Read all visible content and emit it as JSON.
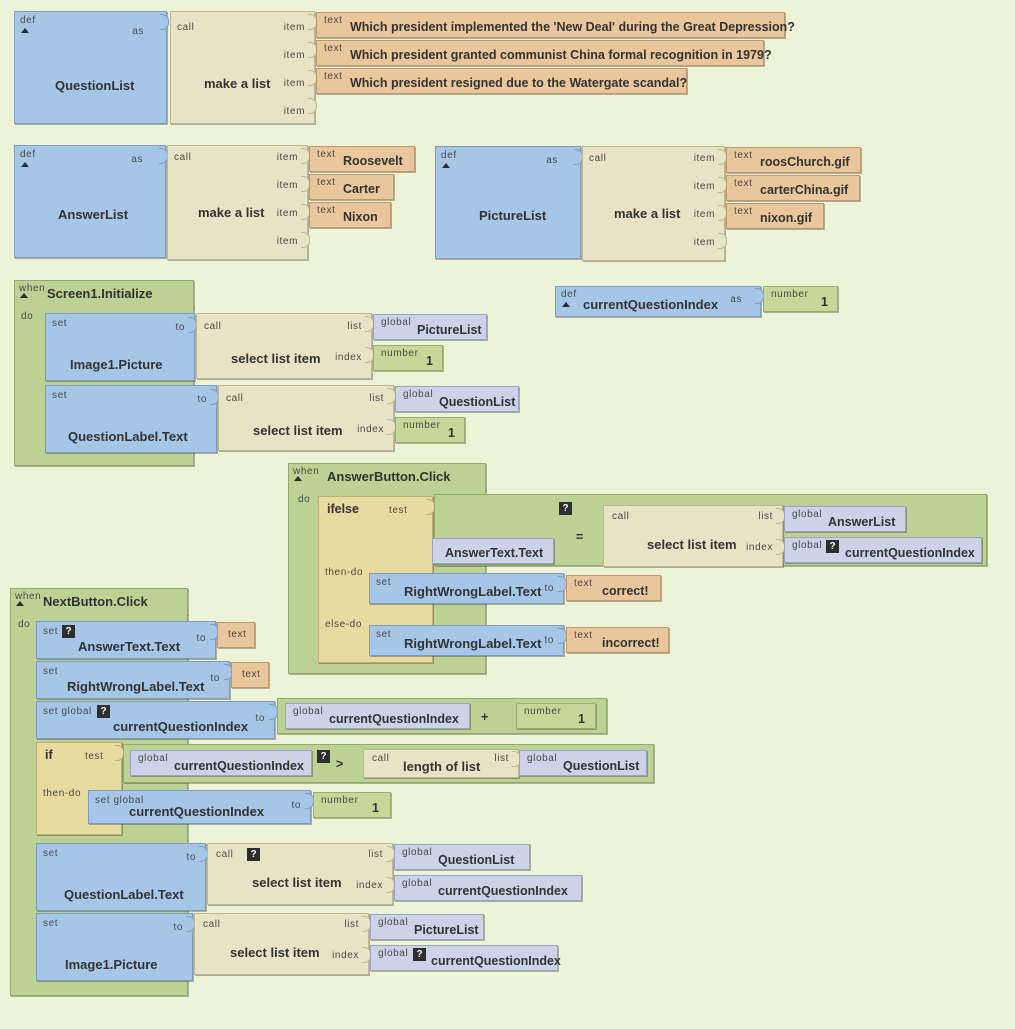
{
  "app": {
    "title": "App Inventor Blocks Editor",
    "canvas_background": "#edf3d6"
  },
  "palette": {
    "variable_blue": "#a6c6e8",
    "call_cream": "#e8e3c4",
    "text_orange": "#e9c69b",
    "event_green": "#bcd194",
    "control_gold": "#e9da9f",
    "global_lavender": "#ccd3e8",
    "number_olive": "#c6d79a"
  },
  "captions": {
    "def": "def",
    "as": "as",
    "call": "call",
    "item": "item",
    "text": "text",
    "to": "to",
    "list": "list",
    "index": "index",
    "number": "number",
    "global": "global",
    "when": "when",
    "do": "do",
    "test": "test",
    "set": "set",
    "set_global": "set global",
    "then_do": "then-do",
    "else_do": "else-do",
    "if": "if",
    "ifelse": "ifelse"
  },
  "blocks": {
    "question_list": {
      "def_name": "QuestionList",
      "make_a_list": "make a list",
      "items": [
        "Which president implemented the 'New Deal' during the Great Depression?",
        "Which president granted communist China formal recognition in 1979?",
        "Which president resigned due to the Watergate scandal?"
      ],
      "empty_sockets": 1
    },
    "answer_list": {
      "def_name": "AnswerList",
      "make_a_list": "make a list",
      "items": [
        "Roosevelt",
        "Carter",
        "Nixon"
      ],
      "empty_sockets": 1
    },
    "picture_list": {
      "def_name": "PictureList",
      "make_a_list": "make a list",
      "items": [
        "roosChurch.gif",
        "carterChina.gif",
        "nixon.gif"
      ],
      "empty_sockets": 1
    },
    "current_question_index_def": {
      "def_name": "currentQuestionIndex",
      "value": "1"
    },
    "screen1_initialize": {
      "event_name": "Screen1.Initialize",
      "statements": [
        {
          "set_target": "Image1.Picture",
          "call_name": "select list item",
          "list_value": "PictureList",
          "index_value": "1",
          "index_kind": "number"
        },
        {
          "set_target": "QuestionLabel.Text",
          "call_name": "select list item",
          "list_value": "QuestionList",
          "index_value": "1",
          "index_kind": "number"
        }
      ]
    },
    "answer_button_click": {
      "event_name": "AnswerButton.Click",
      "ifelse": {
        "test": {
          "operator": "=",
          "left": "AnswerText.Text",
          "right": {
            "call_name": "select list item",
            "list_value": "AnswerList",
            "index_value": "currentQuestionIndex",
            "index_kind": "global",
            "index_warning": "?"
          },
          "warning": "?"
        },
        "then_do": {
          "set_target": "RightWrongLabel.Text",
          "text_value": "correct!"
        },
        "else_do": {
          "set_target": "RightWrongLabel.Text",
          "text_value": "incorrect!"
        }
      }
    },
    "next_button_click": {
      "event_name": "NextButton.Click",
      "statements": [
        {
          "kind": "set-text",
          "set_target": "AnswerText.Text",
          "warning": "?",
          "text_value": ""
        },
        {
          "kind": "set-text",
          "set_target": "RightWrongLabel.Text",
          "text_value": ""
        },
        {
          "kind": "set-global-sum",
          "set_target": "currentQuestionIndex",
          "warning": "?",
          "left": "currentQuestionIndex",
          "operator": "+",
          "right_value": "1"
        },
        {
          "kind": "if",
          "test": {
            "left": "currentQuestionIndex",
            "operator": ">",
            "warning": "?",
            "right": {
              "call_name": "length of list",
              "list_value": "QuestionList"
            }
          },
          "then_do": {
            "set_target": "currentQuestionIndex",
            "value": "1",
            "value_kind": "number"
          }
        },
        {
          "kind": "set-select",
          "set_target": "QuestionLabel.Text",
          "warning": "?",
          "call_name": "select list item",
          "list_value": "QuestionList",
          "index_value": "currentQuestionIndex",
          "index_kind": "global"
        },
        {
          "kind": "set-select",
          "set_target": "Image1.Picture",
          "call_name": "select list item",
          "list_value": "PictureList",
          "index_value": "currentQuestionIndex",
          "index_kind": "global",
          "index_warning": "?"
        }
      ]
    }
  }
}
